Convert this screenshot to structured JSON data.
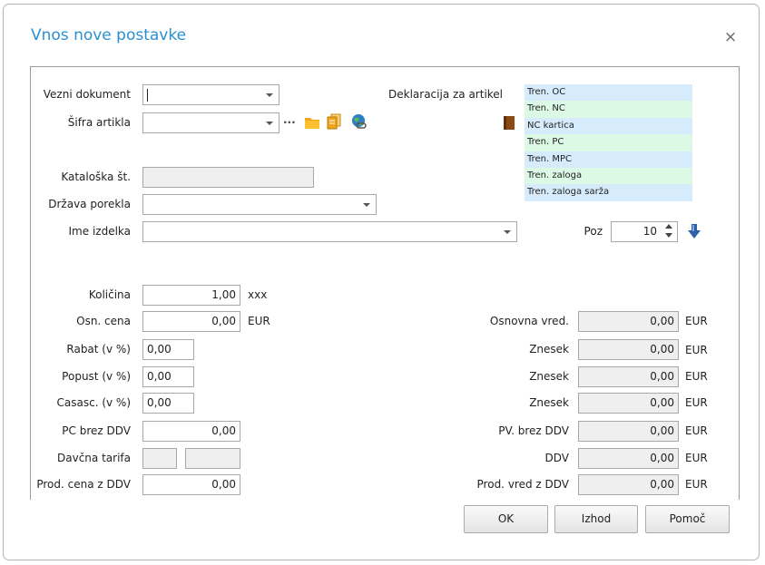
{
  "dialog": {
    "title": "Vnos nove postavke",
    "close_glyph": "×"
  },
  "fields": {
    "vezni_dokument": {
      "label": "Vezni dokument",
      "value": ""
    },
    "sifra_artikla": {
      "label": "Šifra artikla",
      "value": "",
      "more_glyph": "···"
    },
    "kataloska": {
      "label": "Kataloška št.",
      "value": ""
    },
    "drzava": {
      "label": "Država porekla",
      "value": ""
    },
    "ime_izdelka": {
      "label": "Ime izdelka",
      "value": ""
    },
    "poz": {
      "label": "Poz",
      "value": "10"
    },
    "kolicina": {
      "label": "Količina",
      "value": "1,00",
      "unit": "xxx"
    },
    "osn_cena": {
      "label": "Osn. cena",
      "value": "0,00",
      "unit": "EUR"
    },
    "rabat": {
      "label": "Rabat (v %)",
      "value": "0,00"
    },
    "popust": {
      "label": "Popust (v %)",
      "value": "0,00"
    },
    "casasc": {
      "label": "Casasc. (v %)",
      "value": "0,00"
    },
    "pc_brez_ddv": {
      "label": "PC brez DDV",
      "value": "0,00"
    },
    "davcna_tarifa": {
      "label": "Davčna tarifa",
      "value1": "",
      "value2": ""
    },
    "prod_cena_z_ddv": {
      "label": "Prod. cena z DDV",
      "value": "0,00"
    }
  },
  "right_fields": {
    "osnovna_vred": {
      "label": "Osnovna vred.",
      "value": "0,00",
      "unit": "EUR"
    },
    "znesek1": {
      "label": "Znesek",
      "value": "0,00",
      "unit": "EUR"
    },
    "znesek2": {
      "label": "Znesek",
      "value": "0,00",
      "unit": "EUR"
    },
    "znesek3": {
      "label": "Znesek",
      "value": "0,00",
      "unit": "EUR"
    },
    "pv_brez_ddv": {
      "label": "PV. brez DDV",
      "value": "0,00",
      "unit": "EUR"
    },
    "ddv": {
      "label": "DDV",
      "value": "0,00",
      "unit": "EUR"
    },
    "prod_vred_z_ddv": {
      "label": "Prod. vred z DDV",
      "value": "0,00",
      "unit": "EUR"
    }
  },
  "declaration": {
    "label": "Deklaracija za artikel",
    "items": [
      "Tren. OC",
      "Tren. NC",
      "NC kartica",
      "Tren. PC",
      "Tren. MPC",
      "Tren. zaloga",
      "Tren. zaloga sarža"
    ]
  },
  "buttons": {
    "ok": "OK",
    "izhod": "Izhod",
    "pomoc": "Pomoč"
  },
  "colors": {
    "title": "#2a8fd0",
    "decl_blue": "#d6ecfc",
    "decl_green": "#dcf9e6"
  },
  "icons": [
    "folder-icon",
    "copy-icon",
    "globe-link-icon",
    "book-icon",
    "down-arrow-icon"
  ]
}
